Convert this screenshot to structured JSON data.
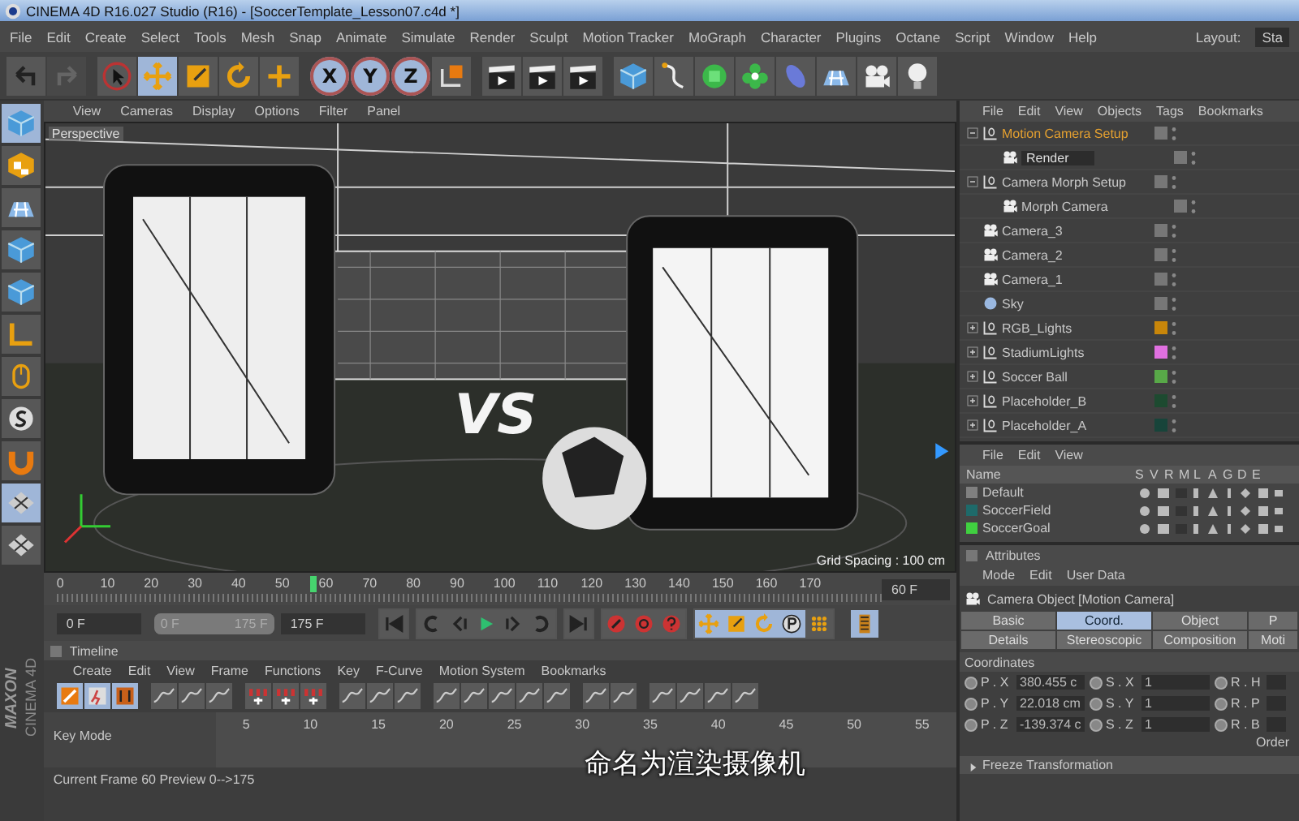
{
  "window": {
    "title": "CINEMA 4D R16.027 Studio (R16) - [SoccerTemplate_Lesson07.c4d *]",
    "layout_label": "Layout:",
    "layout_value": "Sta"
  },
  "menu": [
    "File",
    "Edit",
    "Create",
    "Select",
    "Tools",
    "Mesh",
    "Snap",
    "Animate",
    "Simulate",
    "Render",
    "Sculpt",
    "Motion Tracker",
    "MoGraph",
    "Character",
    "Plugins",
    "Octane",
    "Script",
    "Window",
    "Help"
  ],
  "toolbar": [
    [
      {
        "kind": "undo"
      },
      {
        "kind": "redo",
        "disabled": true
      }
    ],
    [
      {
        "kind": "select",
        "selected": false
      },
      {
        "kind": "move",
        "selected": true
      },
      {
        "kind": "scale",
        "selected": false
      },
      {
        "kind": "rotate",
        "selected": false
      },
      {
        "kind": "add",
        "selected": false
      }
    ],
    [
      {
        "kind": "axis",
        "label": "X",
        "selected": true
      },
      {
        "kind": "axis",
        "label": "Y",
        "selected": true
      },
      {
        "kind": "axis",
        "label": "Z",
        "selected": true
      },
      {
        "kind": "coords"
      }
    ],
    [
      {
        "kind": "clapper"
      },
      {
        "kind": "clapper"
      },
      {
        "kind": "clapper"
      }
    ],
    [
      {
        "kind": "cube"
      },
      {
        "kind": "spline"
      },
      {
        "kind": "sphere"
      },
      {
        "kind": "flower"
      },
      {
        "kind": "blob"
      },
      {
        "kind": "floor"
      },
      {
        "kind": "camera"
      },
      {
        "kind": "bulb"
      }
    ]
  ],
  "left_tools": [
    {
      "kind": "cube",
      "selected": true
    },
    {
      "kind": "checker",
      "selected": false
    },
    {
      "kind": "floor",
      "selected": false
    },
    {
      "kind": "cube",
      "selected": false
    },
    {
      "kind": "cube",
      "selected": false
    },
    {
      "kind": "axes",
      "selected": false
    },
    {
      "kind": "mouse",
      "selected": false
    },
    {
      "kind": "snap",
      "selected": false
    },
    {
      "kind": "magnet",
      "selected": false
    },
    {
      "kind": "grid",
      "selected": true
    },
    {
      "kind": "grid",
      "selected": false
    }
  ],
  "logo": {
    "brand": "MAXON",
    "product": "CINEMA 4D"
  },
  "viewport": {
    "menu": [
      "View",
      "Cameras",
      "Display",
      "Options",
      "Filter",
      "Panel"
    ],
    "camera_label": "Perspective",
    "scene_logo": "VS",
    "grid_info": "Grid Spacing : 100 cm"
  },
  "frame_ruler": {
    "ticks": [
      "0",
      "10",
      "20",
      "30",
      "40",
      "50",
      "60",
      "70",
      "80",
      "90",
      "100",
      "110",
      "120",
      "130",
      "140",
      "150",
      "160",
      "170"
    ],
    "playhead": {
      "level": 0.343
    },
    "current_field": "60 F"
  },
  "playback": {
    "start_field": "0 F",
    "range": {
      "start": "0 F",
      "end": "175 F",
      "level": 1
    },
    "end_field": "175 F",
    "key_buttons": [
      {
        "kind": "move",
        "selected": true
      },
      {
        "kind": "scale",
        "selected": true
      },
      {
        "kind": "rotate",
        "selected": true
      },
      {
        "kind": "param",
        "selected": true
      },
      {
        "kind": "pla",
        "selected": false
      }
    ],
    "film_selected": true
  },
  "timeline": {
    "title": "Timeline",
    "menu": [
      "Create",
      "Edit",
      "View",
      "Frame",
      "Functions",
      "Key",
      "F-Curve",
      "Motion System",
      "Bookmarks"
    ],
    "key_mode": "Key Mode",
    "ticks": [
      "5",
      "10",
      "15",
      "20",
      "25",
      "30",
      "35",
      "40",
      "45",
      "50",
      "55"
    ],
    "status": "Current Frame  60  Preview  0-->175"
  },
  "subtitle": "命名为渲染摄像机",
  "objects": {
    "menu": [
      "File",
      "Edit",
      "View",
      "Objects",
      "Tags",
      "Bookmarks"
    ],
    "items": [
      {
        "name": "Motion Camera Setup",
        "kind": "null",
        "selected": true,
        "expanded": true,
        "children": [
          {
            "name": "Render",
            "kind": "camera",
            "editing": true
          }
        ]
      },
      {
        "name": "Camera Morph Setup",
        "kind": "null",
        "selected": false,
        "expanded": true,
        "children": [
          {
            "name": "Morph Camera",
            "kind": "camera",
            "selected": false
          }
        ]
      },
      {
        "name": "Camera_3",
        "kind": "camera",
        "selected": false
      },
      {
        "name": "Camera_2",
        "kind": "camera",
        "selected": false
      },
      {
        "name": "Camera_1",
        "kind": "camera",
        "selected": false
      },
      {
        "name": "Sky",
        "kind": "sky",
        "selected": false
      },
      {
        "name": "RGB_Lights",
        "kind": "null",
        "selected": false,
        "expanded": false,
        "color": "#c8860a"
      },
      {
        "name": "StadiumLights",
        "kind": "null",
        "selected": false,
        "expanded": false,
        "color": "#e070e0"
      },
      {
        "name": "Soccer Ball",
        "kind": "null",
        "selected": false,
        "expanded": false,
        "color": "#58a848"
      },
      {
        "name": "Placeholder_B",
        "kind": "null",
        "selected": false,
        "expanded": false,
        "color": "#1d4a30"
      },
      {
        "name": "Placeholder_A",
        "kind": "null",
        "selected": false,
        "expanded": false,
        "color": "#17443a"
      }
    ]
  },
  "layers": {
    "menu": [
      "File",
      "Edit",
      "View"
    ],
    "columns": [
      "Name",
      "S",
      "V",
      "R",
      "M",
      "L",
      "A",
      "G",
      "D",
      "E"
    ],
    "rows": [
      {
        "name": "Default",
        "color": "#808080"
      },
      {
        "name": "SoccerField",
        "color": "#1e6a6a"
      },
      {
        "name": "SoccerGoal",
        "color": "#40d040"
      }
    ]
  },
  "attributes": {
    "title": "Attributes",
    "menu": [
      "Mode",
      "Edit",
      "User Data"
    ],
    "object_title": "Camera Object [Motion Camera]",
    "tabs": [
      {
        "label": "Basic",
        "selected": false
      },
      {
        "label": "Coord.",
        "selected": true
      },
      {
        "label": "Object",
        "selected": false
      },
      {
        "label": "P",
        "selected": false
      },
      {
        "label": "Details",
        "selected": false
      },
      {
        "label": "Stereoscopic",
        "selected": false
      },
      {
        "label": "Composition",
        "selected": false
      },
      {
        "label": "Moti",
        "selected": false
      }
    ],
    "section": "Coordinates",
    "rows": [
      [
        {
          "label": "P . X",
          "value": "380.455 c"
        },
        {
          "label": "S . X",
          "value": "1"
        },
        {
          "label": "R . H"
        }
      ],
      [
        {
          "label": "P . Y",
          "value": "22.018 cm"
        },
        {
          "label": "S . Y",
          "value": "1"
        },
        {
          "label": "R . P"
        }
      ],
      [
        {
          "label": "P . Z",
          "value": "-139.374 c"
        },
        {
          "label": "S . Z",
          "value": "1"
        },
        {
          "label": "R . B"
        }
      ]
    ],
    "order_label": "Order",
    "freeze": "Freeze Transformation"
  }
}
